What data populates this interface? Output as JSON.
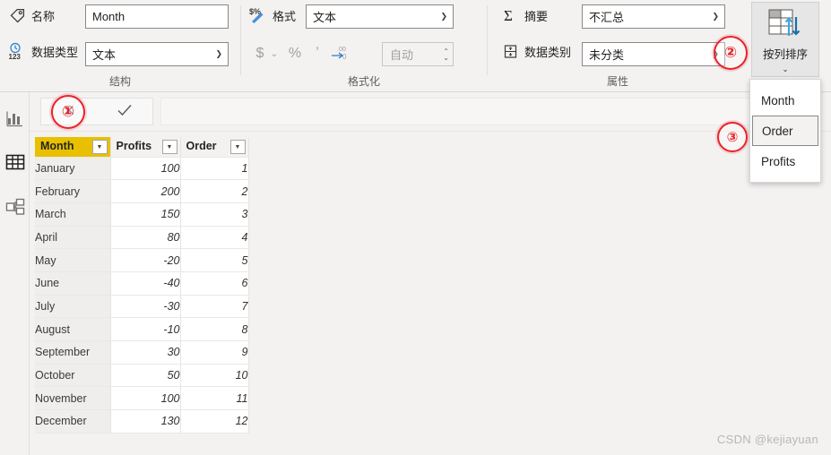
{
  "ribbon": {
    "groups": [
      {
        "key": "structure",
        "label": "结构"
      },
      {
        "key": "formatting",
        "label": "格式化"
      },
      {
        "key": "properties",
        "label": "属性"
      }
    ],
    "structure": {
      "name_icon": "tag-icon",
      "name_label": "名称",
      "name_value": "Month",
      "datatype_icon": "datatype-123-icon",
      "datatype_label": "数据类型",
      "datatype_value": "文本"
    },
    "formatting": {
      "format_icon": "currency-percent-icon",
      "format_label": "格式",
      "format_value": "文本",
      "currency_icon": "$",
      "currency_chevron": "⌄",
      "percent_icon": "%",
      "thousands_icon": "ʼ",
      "decimal_icon": ".00",
      "decimal_places_value": "自动",
      "spin_up": "⌃",
      "spin_down": "⌄"
    },
    "properties": {
      "summarize_icon": "sigma-icon",
      "summarize_label": "摘要",
      "summarize_value": "不汇总",
      "category_icon": "data-category-icon",
      "category_label": "数据类别",
      "category_value": "未分类"
    },
    "sort_button": {
      "icon": "sort-by-column-icon",
      "label": "按列排序",
      "chevron": "⌄"
    },
    "sort_menu": {
      "items": [
        {
          "label": "Month",
          "selected": false
        },
        {
          "label": "Order",
          "selected": true
        },
        {
          "label": "Profits",
          "selected": false
        }
      ]
    }
  },
  "rail": {
    "items": [
      {
        "name": "report-view",
        "icon": "bar-chart-icon",
        "active": false
      },
      {
        "name": "data-view",
        "icon": "table-icon",
        "active": true
      },
      {
        "name": "model-view",
        "icon": "relationships-icon",
        "active": false
      }
    ]
  },
  "formula_bar": {
    "cancel_icon": "cancel-x-icon",
    "accept_icon": "check-icon",
    "input_value": "",
    "input_placeholder": ""
  },
  "table": {
    "columns": [
      {
        "key": "month",
        "label": "Month",
        "selected": true,
        "align": "left"
      },
      {
        "key": "profits",
        "label": "Profits",
        "selected": false,
        "align": "right"
      },
      {
        "key": "order",
        "label": "Order",
        "selected": false,
        "align": "right"
      }
    ],
    "filter_icon": "▼",
    "rows": [
      {
        "month": "January",
        "profits": "100",
        "order": "1"
      },
      {
        "month": "February",
        "profits": "200",
        "order": "2"
      },
      {
        "month": "March",
        "profits": "150",
        "order": "3"
      },
      {
        "month": "April",
        "profits": "80",
        "order": "4"
      },
      {
        "month": "May",
        "profits": "-20",
        "order": "5"
      },
      {
        "month": "June",
        "profits": "-40",
        "order": "6"
      },
      {
        "month": "July",
        "profits": "-30",
        "order": "7"
      },
      {
        "month": "August",
        "profits": "-10",
        "order": "8"
      },
      {
        "month": "September",
        "profits": "30",
        "order": "9"
      },
      {
        "month": "October",
        "profits": "50",
        "order": "10"
      },
      {
        "month": "November",
        "profits": "100",
        "order": "11"
      },
      {
        "month": "December",
        "profits": "130",
        "order": "12"
      }
    ]
  },
  "annotations": [
    {
      "label": "①",
      "name": "step-1-marker"
    },
    {
      "label": "②",
      "name": "step-2-marker"
    },
    {
      "label": "③",
      "name": "step-3-marker"
    }
  ],
  "watermark": {
    "text": "CSDN @kejiayuan"
  },
  "colors": {
    "selected_header": "#e8c000",
    "annotation_red": "#e8222a",
    "ribbon_bg": "#f3f2f1"
  }
}
